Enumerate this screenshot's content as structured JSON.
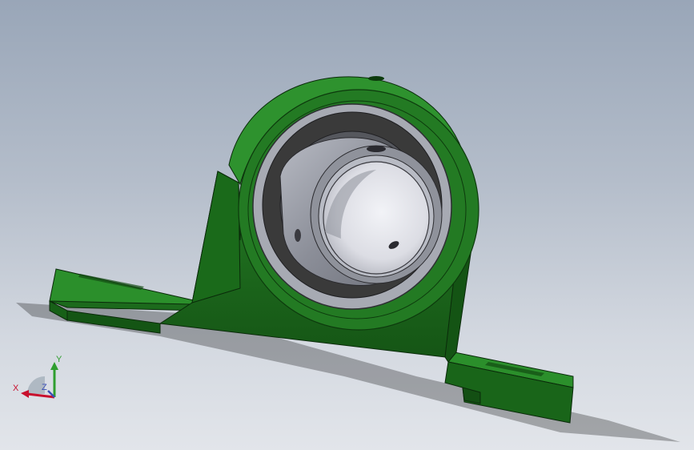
{
  "viewport": {
    "part_color": "#1d6e1d",
    "insert_color": "#a0a3ac",
    "seal_color": "#3a3a3a"
  },
  "triad": {
    "x_label": "X",
    "y_label": "Y",
    "z_label": "Z",
    "x_color": "#c8102e",
    "y_color": "#2f9e2f",
    "z_color": "#3b4fb5"
  }
}
